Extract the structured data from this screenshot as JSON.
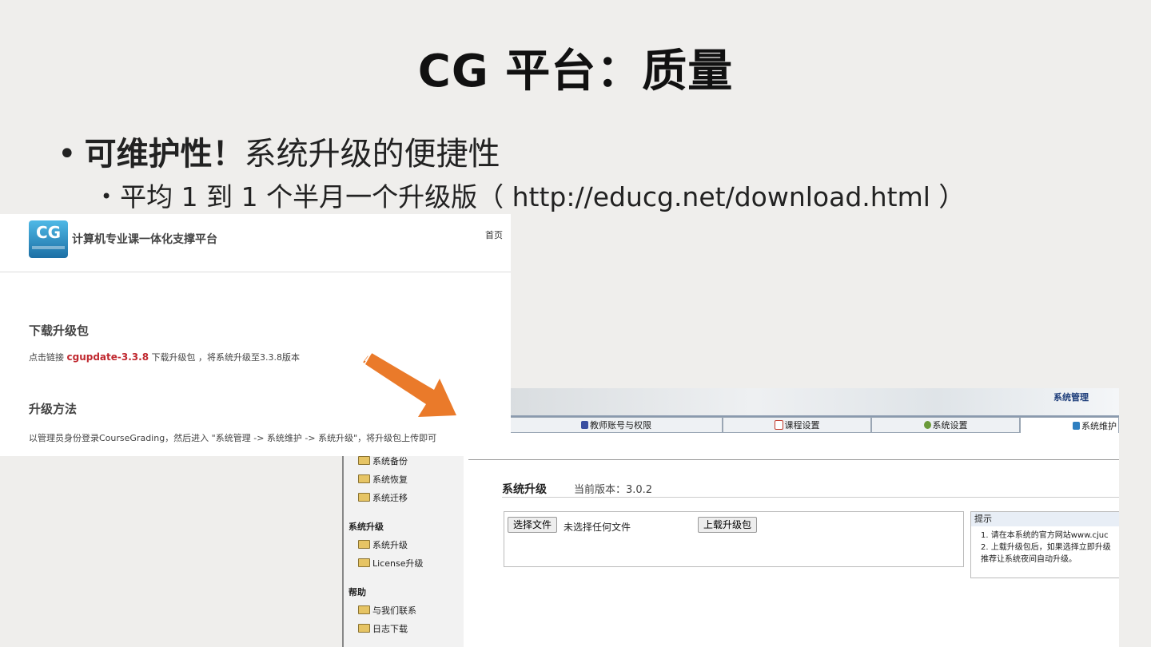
{
  "slide": {
    "title": "CG 平台：质量",
    "bullet1_strong": "可维护性！",
    "bullet1_rest": "系统升级的便捷性",
    "bullet2": "平均 1 到 1 个半月一个升级版（  http://educg.net/download.html  ）"
  },
  "download_page": {
    "logo_text": "CG",
    "site_title": "计算机专业课一体化支撑平台",
    "nav_home": "首页",
    "section1_heading": "下载升级包",
    "section1_prefix": "点击链接",
    "section1_link": "cgupdate-3.3.8",
    "section1_suffix": "下载升级包 ，将系统升级至3.3.8版本",
    "section2_heading": "升级方法",
    "section2_text": "以管理员身份登录CourseGrading，然后进入 \"系统管理 -> 系统维护 -> 系统升级\"，将升级包上传即可"
  },
  "admin_page": {
    "banner_title": "系统管理",
    "tabs": [
      {
        "label": "教师账号与权限",
        "icon": "users-icon",
        "color": "#3a4fa0"
      },
      {
        "label": "课程设置",
        "icon": "document-icon",
        "color": "#c0392b"
      },
      {
        "label": "系统设置",
        "icon": "gear-icon",
        "color": "#6a9a3a"
      },
      {
        "label": "系统维护",
        "icon": "toolbox-icon",
        "color": "#2e7fc0"
      }
    ],
    "sidebar": {
      "group1_items": [
        "系统备份",
        "系统恢复",
        "系统迁移"
      ],
      "group2_heading": "系统升级",
      "group2_items": [
        "系统升级",
        "License升级"
      ],
      "group3_heading": "帮助",
      "group3_items": [
        "与我们联系",
        "日志下载"
      ]
    },
    "main_title": "系统升级",
    "version_label": "当前版本：3.0.2",
    "choose_file_button": "选择文件",
    "no_file_text": "未选择任何文件",
    "upload_button": "上载升级包",
    "tip_heading": "提示",
    "tip_lines": [
      "1. 请在本系统的官方网站www.cjuc",
      "2. 上载升级包后，如果选择立即升级",
      "    推荐让系统夜间自动升级。"
    ]
  },
  "colors": {
    "accent_arrow": "#ea7a2a",
    "link_red": "#c0282f"
  }
}
